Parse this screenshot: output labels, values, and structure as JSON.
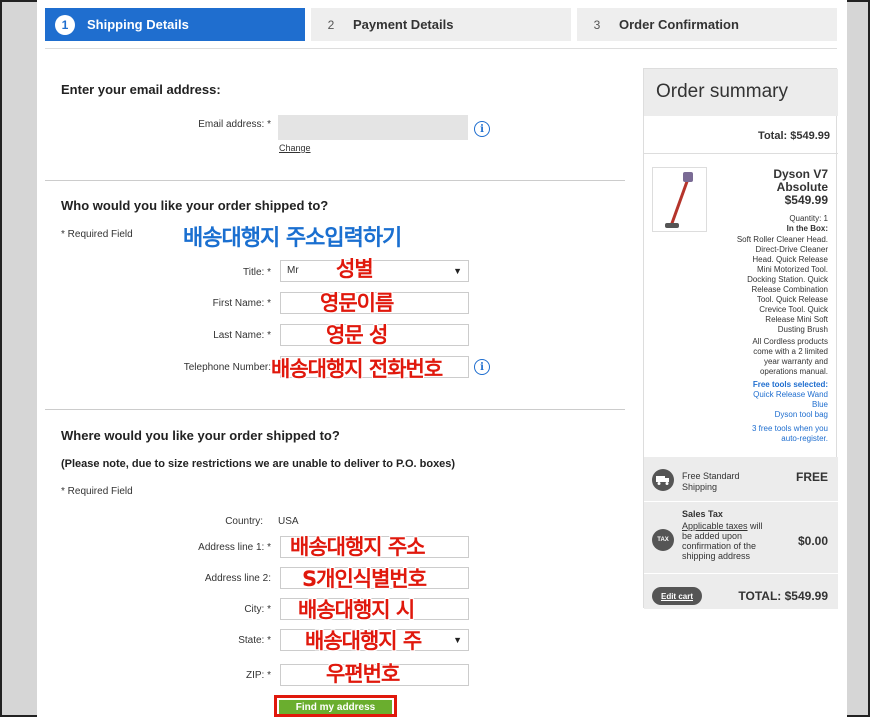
{
  "steps": [
    {
      "num": "1",
      "label": "Shipping Details"
    },
    {
      "num": "2",
      "label": "Payment Details"
    },
    {
      "num": "3",
      "label": "Order Confirmation"
    }
  ],
  "email_section": {
    "title": "Enter your email address:",
    "label": "Email address: *",
    "value": "",
    "change_link": "Change"
  },
  "name_section": {
    "title": "Who would you like your order shipped to?",
    "required": "* Required Field",
    "title_label": "Title: *",
    "title_value": "Mr",
    "first_name_label": "First Name: *",
    "last_name_label": "Last Name: *",
    "phone_label": "Telephone Number:"
  },
  "address_section": {
    "title": "Where would you like your order shipped to?",
    "note": "(Please note, due to size restrictions we are unable to deliver to P.O. boxes)",
    "required": "* Required Field",
    "country_label": "Country:",
    "country_value": "USA",
    "line1_label": "Address line 1: *",
    "line2_label": "Address line 2:",
    "city_label": "City: *",
    "state_label": "State: *",
    "zip_label": "ZIP: *",
    "find_button": "Find my address"
  },
  "annotations": {
    "shipping_header": "배송대행지 주소입력하기",
    "gender": "성별",
    "first_name": "영문이름",
    "last_name": "영문 성",
    "phone": "배송대행지 전화번호",
    "address1": "배송대행지 주소",
    "address2": "S개인식별번호",
    "city": "배송대행지 시",
    "state": "배송대행지 주",
    "zip": "우편번호"
  },
  "summary": {
    "title": "Order summary",
    "total_top": "Total: $549.99",
    "product_name_1": "Dyson V7",
    "product_name_2": "Absolute",
    "product_price": "$549.99",
    "quantity": "Quantity: 1",
    "in_box_label": "In the Box:",
    "in_box_lines": [
      "Soft Roller Cleaner Head.",
      "Direct-Drive Cleaner",
      "Head. Quick Release",
      "Mini Motorized Tool.",
      "Docking Station. Quick",
      "Release Combination",
      "Tool. Quick Release",
      "Crevice Tool. Quick",
      "Release Mini Soft",
      "Dusting Brush"
    ],
    "warranty_lines": [
      "All Cordless products",
      "come with a 2 limited",
      "year warranty and",
      "operations manual."
    ],
    "free_tools_label": "Free tools selected:",
    "free_tools_lines": [
      "Quick Release Wand",
      "Blue",
      "Dyson tool bag"
    ],
    "register_lines": [
      "3 free tools when you",
      "auto-register."
    ],
    "shipping_label_1": "Free Standard",
    "shipping_label_2": "Shipping",
    "shipping_value": "FREE",
    "tax_title": "Sales Tax",
    "tax_link": "Applicable taxes",
    "tax_lines": [
      " will",
      "be added upon",
      "confirmation of the",
      "shipping address"
    ],
    "tax_icon": "TAX",
    "tax_value": "$0.00",
    "edit_cart": "Edit cart",
    "total_bottom": "TOTAL: $549.99"
  },
  "colors": {
    "accent": "#1f6ecf",
    "button_green": "#6aae2e",
    "annotation_red": "#e0180c",
    "annotation_blue": "#1a6fd0"
  },
  "icons": [
    "info-icon",
    "truck-icon",
    "tax-icon",
    "chevron-down-icon"
  ]
}
